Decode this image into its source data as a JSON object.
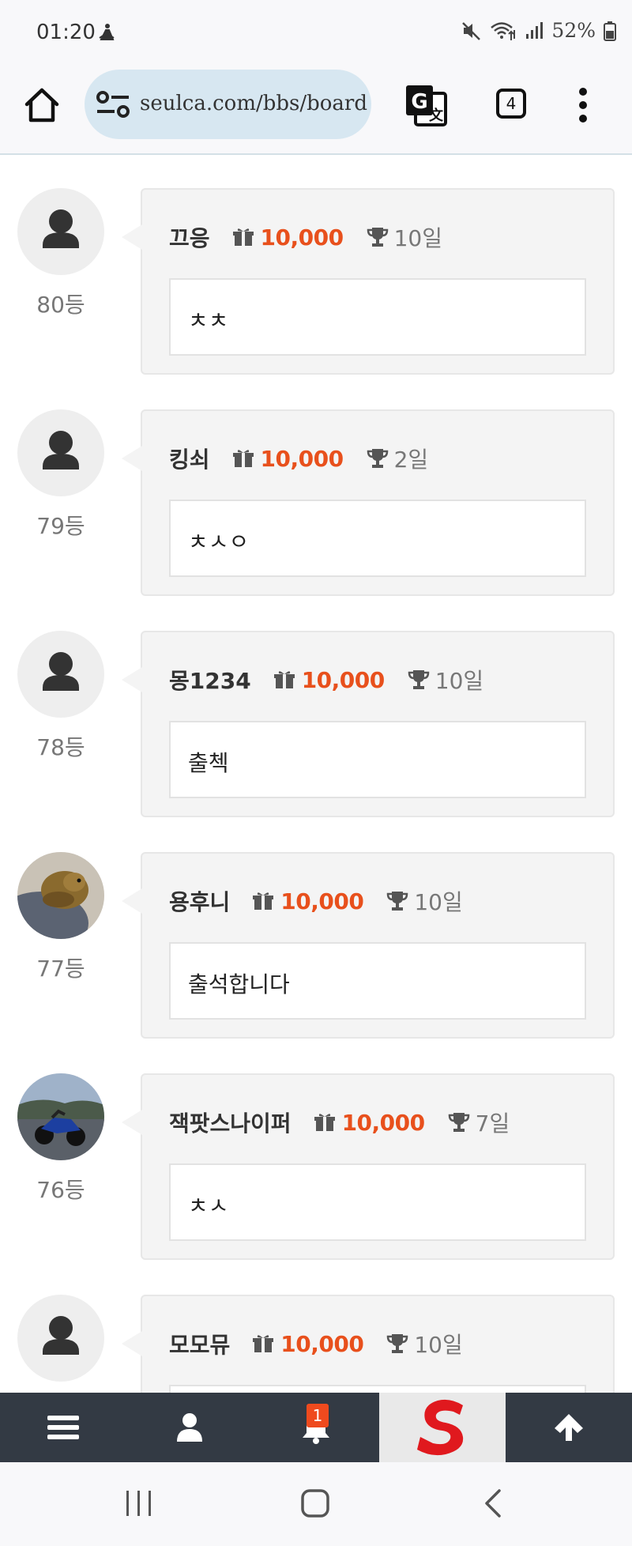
{
  "status_bar": {
    "time": "01:20",
    "battery": "52%"
  },
  "browser": {
    "url": "seulca.com/bbs/board",
    "tab_count": "4"
  },
  "entries": [
    {
      "nickname": "끄응",
      "points": "10,000",
      "days": "10일",
      "message": "ㅊㅊ",
      "rank": "80등",
      "avatar": "default"
    },
    {
      "nickname": "킹쇠",
      "points": "10,000",
      "days": "2일",
      "message": "ㅊㅅㅇ",
      "rank": "79등",
      "avatar": "default"
    },
    {
      "nickname": "몽1234",
      "points": "10,000",
      "days": "10일",
      "message": "출첵",
      "rank": "78등",
      "avatar": "default"
    },
    {
      "nickname": "용후니",
      "points": "10,000",
      "days": "10일",
      "message": "출석합니다",
      "rank": "77등",
      "avatar": "photo-bird"
    },
    {
      "nickname": "잭팟스나이퍼",
      "points": "10,000",
      "days": "7일",
      "message": "ㅊㅅ",
      "rank": "76등",
      "avatar": "photo-motorcycle"
    },
    {
      "nickname": "모모뮤",
      "points": "10,000",
      "days": "10일",
      "message": "",
      "rank": "",
      "avatar": "default"
    }
  ],
  "bottom_nav": {
    "notification_count": "1",
    "items": [
      "menu-icon",
      "user-icon",
      "bell-icon",
      "site-logo",
      "arrow-up-icon"
    ]
  },
  "colors": {
    "points": "#e8501c",
    "nav_bg": "#333a44",
    "badge": "#ef4a1e"
  }
}
